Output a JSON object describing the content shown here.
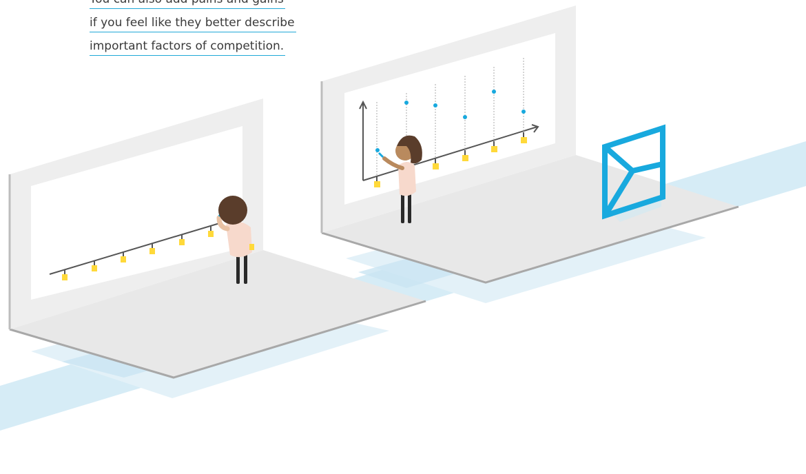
{
  "caption": {
    "lines": [
      "You can also add pains and gains",
      "if you feel like they better describe",
      "important factors of competition."
    ]
  },
  "colors": {
    "accent_blue": "#18a9de",
    "light_blue": "#cfe9f4",
    "sticky_yellow": "#ffd93a",
    "wall": "#eeeeee",
    "floor": "#e6e6e6"
  },
  "scenes": [
    {
      "name": "timeline-wall",
      "sticky_notes": 7
    },
    {
      "name": "strategy-canvas-wall",
      "sticky_notes": 6,
      "points": 6
    }
  ],
  "icons": [
    "canvas-frame-icon"
  ]
}
